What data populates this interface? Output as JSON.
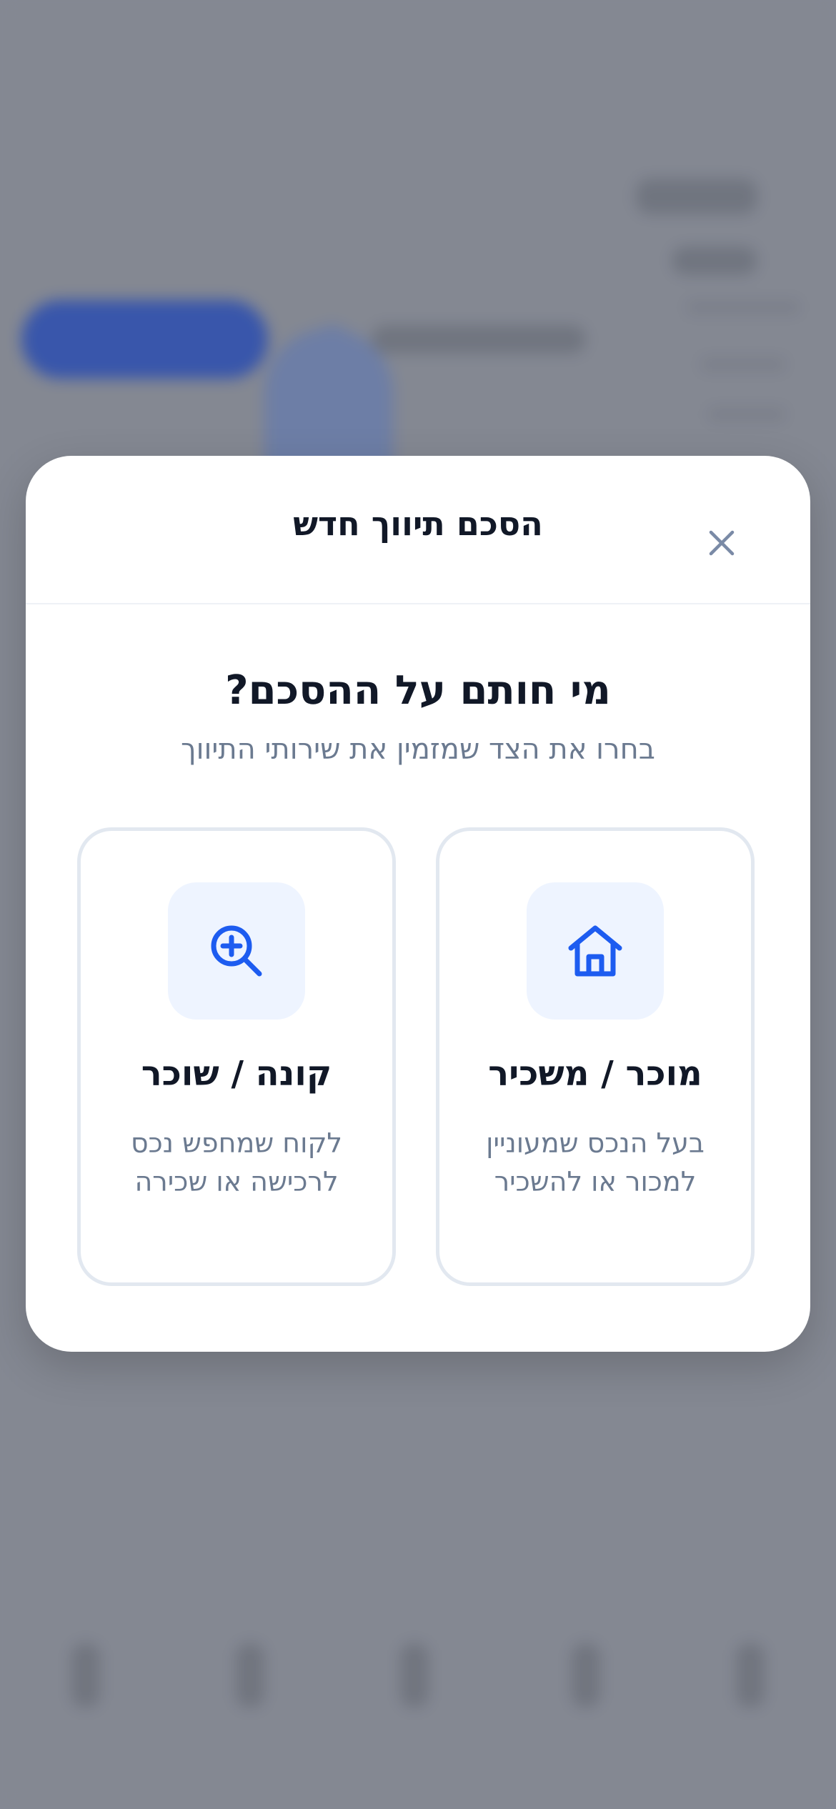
{
  "modal": {
    "title": "הסכם תיווך חדש",
    "question": "מי חותם על ההסכם?",
    "subtitle": "בחרו את הצד שמזמין את שירותי התיווך",
    "options": [
      {
        "id": "seller",
        "icon": "house-icon",
        "title": "מוכר / משכיר",
        "description": "בעל הנכס שמעוניין למכור או להשכיר"
      },
      {
        "id": "buyer",
        "icon": "search-plus-icon",
        "title": "קונה / שוכר",
        "description": "לקוח שמחפש נכס לרכישה או שכירה"
      }
    ]
  },
  "colors": {
    "accent": "#1d5cf0",
    "icon_bg": "#eef4ff",
    "title_text": "#111827",
    "muted_text": "#6b7a90",
    "card_border": "#e2e8f0",
    "close_icon": "#7a8aa6"
  }
}
